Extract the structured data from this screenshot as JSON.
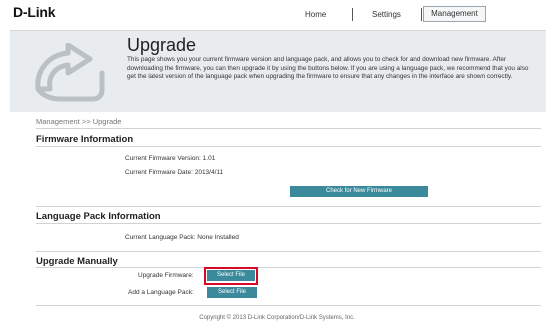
{
  "header": {
    "logo": "D-Link",
    "nav": [
      {
        "label": "Home"
      },
      {
        "label": "Settings"
      },
      {
        "label": "Management"
      }
    ]
  },
  "banner": {
    "icon": "upgrade-arrow-icon",
    "title": "Upgrade",
    "description": "This page shows you your current firmware version and language pack, and allows you to check for and download new firmware. After downloading the firmware, you can then upgrade it by using the buttons below. If you are using a language pack, we recommend that you also get the latest version of the language pack when upgrading the firmware to ensure that any changes in the interface are shown correctly."
  },
  "breadcrumb": "Management >> Upgrade",
  "firmware": {
    "title": "Firmware Information",
    "version": "Current Firmware Version: 1.01",
    "date": "Current Firmware Date: 2013/4/11",
    "check_button": "Check for New Firmware"
  },
  "language_pack": {
    "title": "Language Pack Information",
    "current": "Current Language Pack: None Installed"
  },
  "upgrade_manually": {
    "title": "Upgrade Manually",
    "firmware_label": "Upgrade Firmware:",
    "language_label": "Add a Language Pack:",
    "select_file": "Select File",
    "highlight_color": "#d40a2a"
  },
  "footer": "Copyright © 2013 D-Link Corporation/D-Link Systems, Inc.",
  "colors": {
    "accent_button": "#3a8a9c",
    "banner_bg": "#e8ecee"
  }
}
